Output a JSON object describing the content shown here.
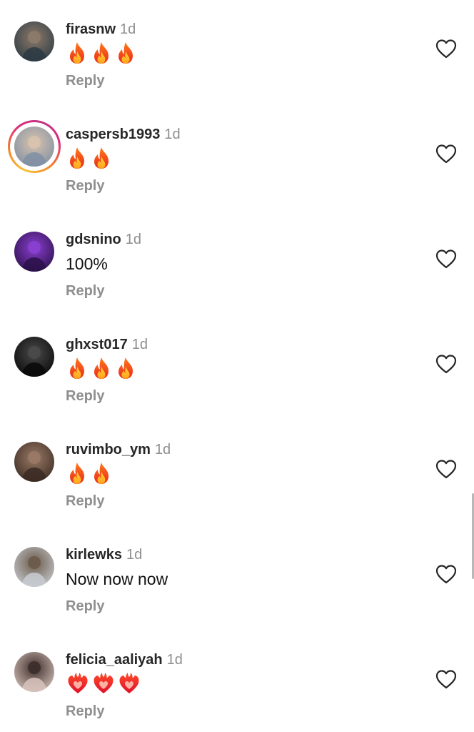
{
  "comments": [
    {
      "username": "firasnw",
      "time": "1d",
      "text": "",
      "emoji": "fire",
      "emoji_count": 3,
      "reply_label": "Reply",
      "avatar_colors": [
        "#2b3a44",
        "#8d7a6a"
      ],
      "story_ring": false
    },
    {
      "username": "caspersb1993",
      "time": "1d",
      "text": "",
      "emoji": "fire",
      "emoji_count": 2,
      "reply_label": "Reply",
      "avatar_colors": [
        "#7f8fa3",
        "#d8c3ae"
      ],
      "story_ring": true
    },
    {
      "username": "gdsnino",
      "time": "1d",
      "text": "100%",
      "emoji": "",
      "emoji_count": 0,
      "reply_label": "Reply",
      "avatar_colors": [
        "#2a1048",
        "#8a3fd0"
      ],
      "story_ring": false
    },
    {
      "username": "ghxst017",
      "time": "1d",
      "text": "",
      "emoji": "fire",
      "emoji_count": 3,
      "reply_label": "Reply",
      "avatar_colors": [
        "#080808",
        "#4a4a4a"
      ],
      "story_ring": false
    },
    {
      "username": "ruvimbo_ym",
      "time": "1d",
      "text": "",
      "emoji": "fire",
      "emoji_count": 2,
      "reply_label": "Reply",
      "avatar_colors": [
        "#3a2a22",
        "#9a7a66"
      ],
      "story_ring": false
    },
    {
      "username": "kirlewks",
      "time": "1d",
      "text": "Now now now",
      "emoji": "",
      "emoji_count": 0,
      "reply_label": "Reply",
      "avatar_colors": [
        "#c8ccd2",
        "#6b5a4a"
      ],
      "story_ring": false
    },
    {
      "username": "felicia_aaliyah",
      "time": "1d",
      "text": "",
      "emoji": "heart-on-fire",
      "emoji_count": 3,
      "reply_label": "Reply",
      "avatar_colors": [
        "#d9c4bd",
        "#3c2d2a"
      ],
      "story_ring": false
    }
  ],
  "colors": {
    "username": "#262626",
    "meta": "#8e8e8e",
    "heart_outline": "#262626"
  },
  "icons": {
    "like": "heart-outline-icon",
    "fire": "fire-emoji-icon",
    "heart_on_fire": "heart-on-fire-emoji-icon"
  }
}
